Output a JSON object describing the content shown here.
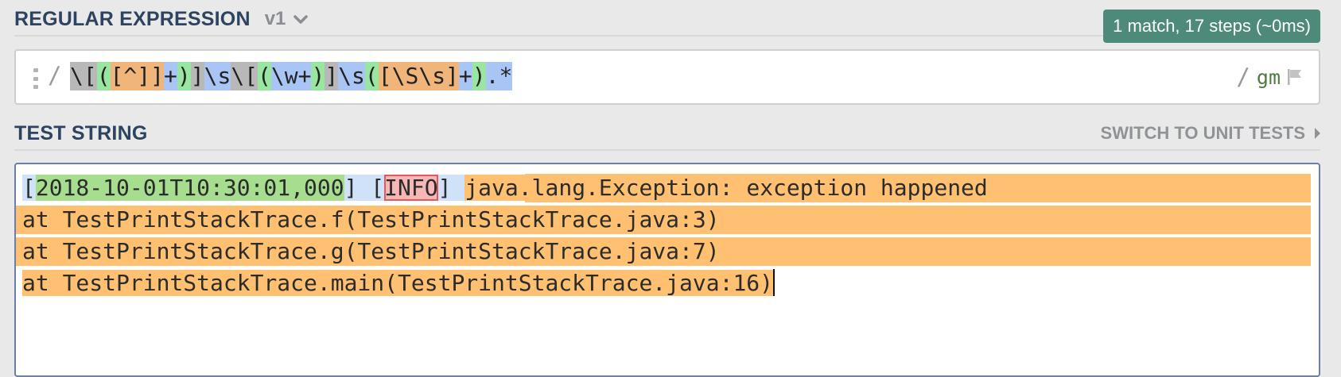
{
  "regex_section": {
    "title": "REGULAR EXPRESSION",
    "version": "v1",
    "match_info": "1 match, 17 steps (~0ms)",
    "open_delimiter": "/",
    "close_delimiter": "/",
    "flags": "gm",
    "tokens": {
      "t1": "\\[",
      "t2": "(",
      "t3": "[^]]",
      "t4": "+",
      "t5": ")",
      "t6": "]",
      "t7": "\\s",
      "t8": "\\[",
      "t9": "(",
      "t10": "\\w+",
      "t11": ")",
      "t12": "]",
      "t13": "\\s",
      "t14": "(",
      "t15": "[\\S\\s]",
      "t16": "+",
      "t17": ")",
      "t18": ".*"
    }
  },
  "test_section": {
    "title": "TEST STRING",
    "switch_label": "SWITCH TO UNIT TESTS",
    "line1": {
      "p1": "[",
      "p2": "2018-10-01T10:30:01,000",
      "p3": "] [",
      "p4": "INFO",
      "p5": "] ",
      "p6": "java.lang.Exception: exception happened"
    },
    "line2": "at TestPrintStackTrace.f(TestPrintStackTrace.java:3)",
    "line3": "at TestPrintStackTrace.g(TestPrintStackTrace.java:7)",
    "line4": "at TestPrintStackTrace.main(TestPrintStackTrace.java:16)"
  },
  "colors": {
    "header_text": "#2d4360",
    "badge": "#4d8a7a",
    "match_orange": "#ffc071",
    "group_green": "#a7dd8e",
    "group_red": "#f7b7b7",
    "match_blue": "#cfe2f8"
  },
  "icons": {
    "version_dropdown": "chevron-down-icon",
    "drag": "drag-handle-icon",
    "flag": "flag-icon",
    "switch": "caret-right-icon"
  }
}
